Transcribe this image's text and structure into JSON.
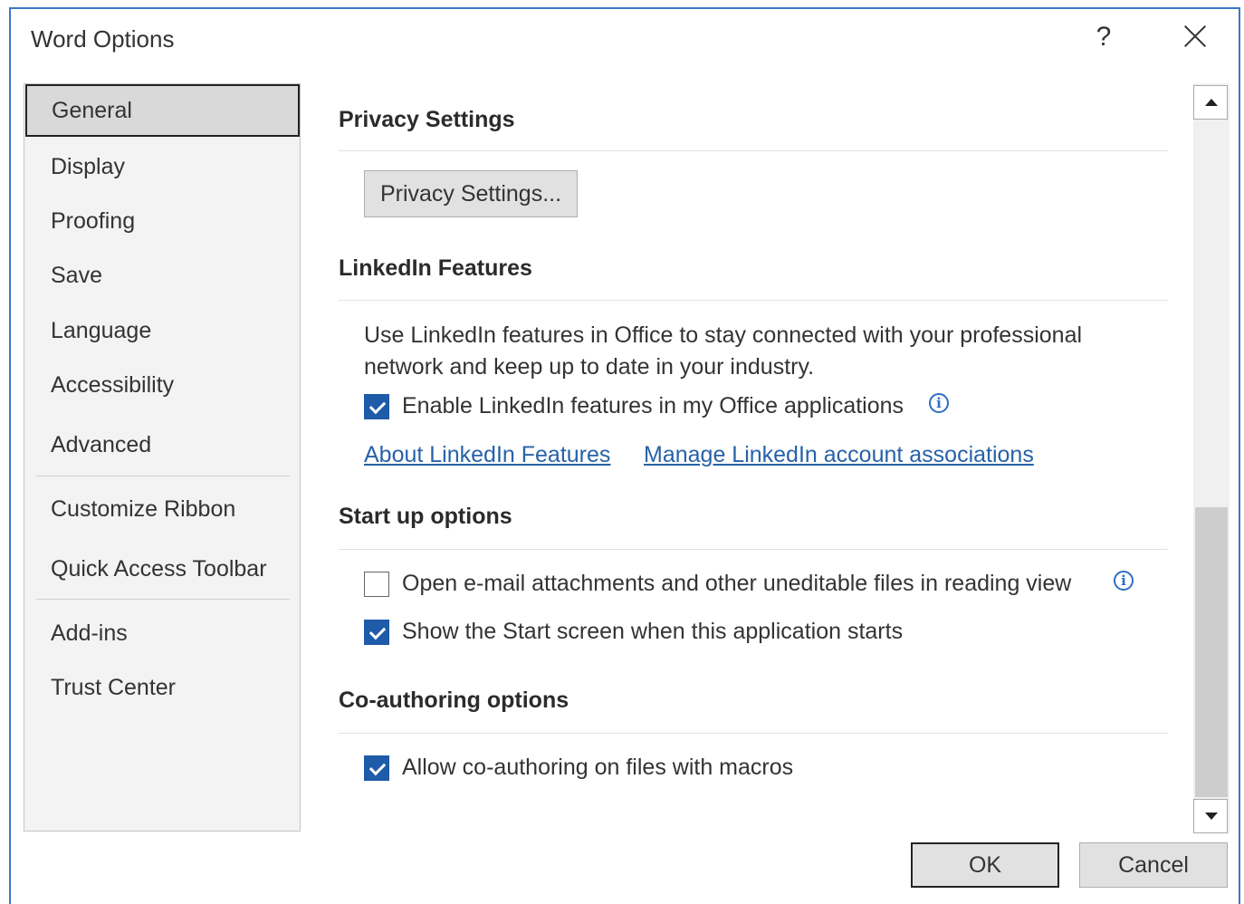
{
  "window": {
    "title": "Word Options",
    "help_label": "?"
  },
  "sidebar": {
    "items": [
      {
        "label": "General",
        "selected": true
      },
      {
        "label": "Display"
      },
      {
        "label": "Proofing"
      },
      {
        "label": "Save"
      },
      {
        "label": "Language"
      },
      {
        "label": "Accessibility"
      },
      {
        "label": "Advanced"
      },
      {
        "label": "Customize Ribbon"
      },
      {
        "label": "Quick Access Toolbar"
      },
      {
        "label": "Add-ins"
      },
      {
        "label": "Trust Center"
      }
    ]
  },
  "privacy": {
    "title": "Privacy Settings",
    "button_label": "Privacy Settings..."
  },
  "linkedin": {
    "title": "LinkedIn Features",
    "description_line1": "Use LinkedIn features in Office to stay connected with your professional",
    "description_line2": "network and keep up to date in your industry.",
    "enable_label": "Enable LinkedIn features in my Office applications",
    "enable_checked": true,
    "about_link": "About LinkedIn Features",
    "manage_link": "Manage LinkedIn account associations"
  },
  "startup": {
    "title": "Start up options",
    "open_attachments_label": "Open e-mail attachments and other uneditable files in reading view",
    "open_attachments_checked": false,
    "show_start_label": "Show the Start screen when this application starts",
    "show_start_checked": true
  },
  "coauthoring": {
    "title": "Co-authoring options",
    "allow_macros_label": "Allow co-authoring on files with macros",
    "allow_macros_checked": true
  },
  "footer": {
    "ok_label": "OK",
    "cancel_label": "Cancel"
  },
  "icons": {
    "info": "info-icon",
    "close": "close-icon",
    "checkmark": "checkmark-icon"
  },
  "colors": {
    "accent": "#1f5ba8",
    "link": "#2762a8",
    "border_blue": "#3c78c8"
  }
}
